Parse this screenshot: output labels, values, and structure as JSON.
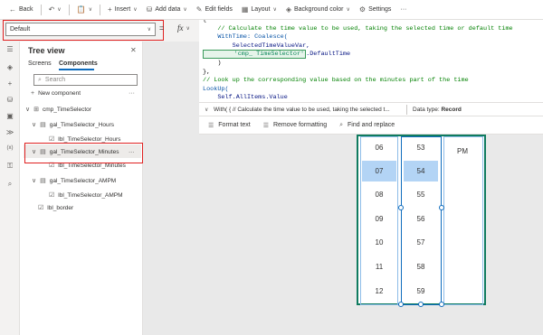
{
  "toolbar": {
    "back": "Back",
    "insert": "Insert",
    "add_data": "Add data",
    "edit_fields": "Edit fields",
    "layout": "Layout",
    "background_color": "Background color",
    "settings": "Settings",
    "more": "···"
  },
  "property_dropdown": {
    "value": "Default"
  },
  "formula_bar": {
    "fx": "fx"
  },
  "tree_view": {
    "title": "Tree view",
    "tabs": [
      "Screens",
      "Components"
    ],
    "search_placeholder": "Search",
    "new_component": "New component",
    "items": [
      "cmp_TimeSelector",
      "gal_TimeSelector_Hours",
      "lbl_TimeSelector_Hours",
      "gal_TimeSelector_Minutes",
      "lbl_TimeSelector_Minutes",
      "gal_TimeSelector_AMPM",
      "lbl_TimeSelector_AMPM",
      "lbl_border"
    ]
  },
  "editor_lines": [
    "{",
    "    // Calculate the time value to be used, taking the selected time or default time",
    "    WithTime: Coalesce(",
    "        SelectedTimeValueVar,",
    "        'cmp_ TimeSelector'",
    "    )",
    "},",
    "// Look up the corresponding value based on the minutes part of the time",
    "LookUp(",
    "    Self.AllItems.Value"
  ],
  "editor_default_suffix": ".DefaultTime",
  "status": {
    "with_text": "With( { // Calculate the time value to be used, taking the selected t...",
    "data_type_label": "Data type:",
    "data_type_value": "Record"
  },
  "format_bar": {
    "format_text": "Format text",
    "remove_formatting": "Remove formatting",
    "find_replace": "Find and replace"
  },
  "time_selector": {
    "hours": [
      "06",
      "07",
      "08",
      "09",
      "10",
      "11",
      "12"
    ],
    "minutes": [
      "53",
      "54",
      "55",
      "56",
      "57",
      "58",
      "59"
    ],
    "ampm": "PM",
    "selected_index": 1
  }
}
